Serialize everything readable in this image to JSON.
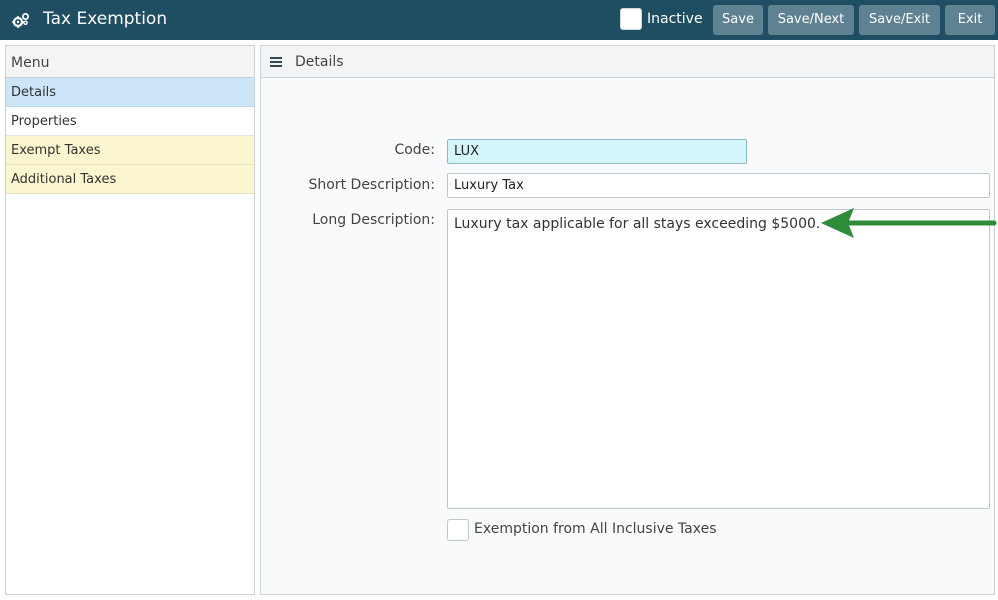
{
  "header": {
    "title": "Tax Exemption",
    "icon": "gears-icon",
    "inactive_label": "Inactive",
    "inactive_checked": false,
    "buttons": {
      "save": "Save",
      "save_next": "Save/Next",
      "save_exit": "Save/Exit",
      "exit": "Exit"
    },
    "colors": {
      "bar": "#1f4e63",
      "button": "#5f8293"
    }
  },
  "menu": {
    "title": "Menu",
    "items": [
      {
        "label": "Details",
        "state": "active"
      },
      {
        "label": "Properties",
        "state": "plain"
      },
      {
        "label": "Exempt Taxes",
        "state": "highlight"
      },
      {
        "label": "Additional Taxes",
        "state": "highlight"
      }
    ]
  },
  "details": {
    "title": "Details",
    "icon": "hamburger-menu-icon",
    "fields": {
      "code_label": "Code:",
      "code_value": "LUX",
      "short_desc_label": "Short Description:",
      "short_desc_value": "Luxury Tax",
      "long_desc_label": "Long Description:",
      "long_desc_value": "Luxury tax applicable for all stays exceeding $5000.",
      "exemption_label": "Exemption from All Inclusive Taxes",
      "exemption_checked": false
    }
  },
  "annotation": {
    "icon": "green-arrow-icon",
    "color": "#2e8b3a"
  }
}
